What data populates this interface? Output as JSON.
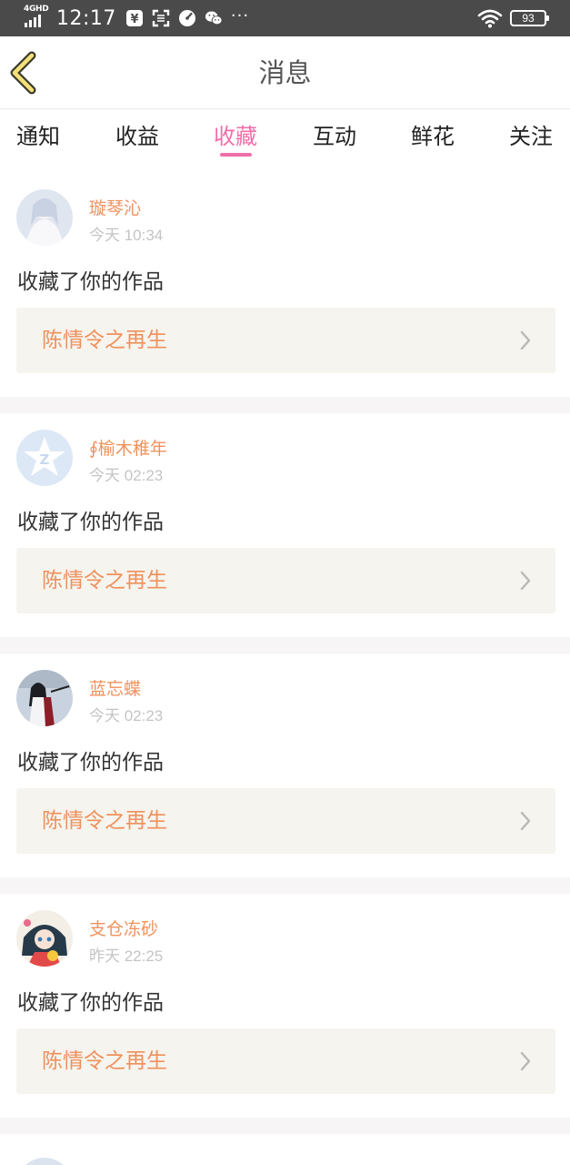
{
  "status_bar": {
    "network": "4GHD",
    "time": "12:17",
    "notification_icons": [
      "yuan-icon",
      "scan-icon",
      "speedometer-icon",
      "wechat-icon"
    ],
    "more": "···",
    "battery": "93"
  },
  "header": {
    "back_icon": "chevron-left-icon",
    "title": "消息"
  },
  "tabs": [
    {
      "label": "通知",
      "active": false
    },
    {
      "label": "收益",
      "active": false
    },
    {
      "label": "收藏",
      "active": true
    },
    {
      "label": "互动",
      "active": false
    },
    {
      "label": "鲜花",
      "active": false
    },
    {
      "label": "关注",
      "active": false
    }
  ],
  "messages": [
    {
      "username": "璇琴沁",
      "time": "今天 10:34",
      "action": "收藏了你的作品",
      "work": "陈情令之再生"
    },
    {
      "username": "∮榆木稚年",
      "time": "今天 02:23",
      "action": "收藏了你的作品",
      "work": "陈情令之再生"
    },
    {
      "username": "蓝忘蝶",
      "time": "今天 02:23",
      "action": "收藏了你的作品",
      "work": "陈情令之再生"
    },
    {
      "username": "支仓冻砂",
      "time": "昨天 22:25",
      "action": "收藏了你的作品",
      "work": "陈情令之再生"
    }
  ],
  "colors": {
    "accent": "#f06ea8",
    "username": "#f0915c",
    "status_bar": "#4a4a4a",
    "card_box": "#f5f4ee"
  }
}
